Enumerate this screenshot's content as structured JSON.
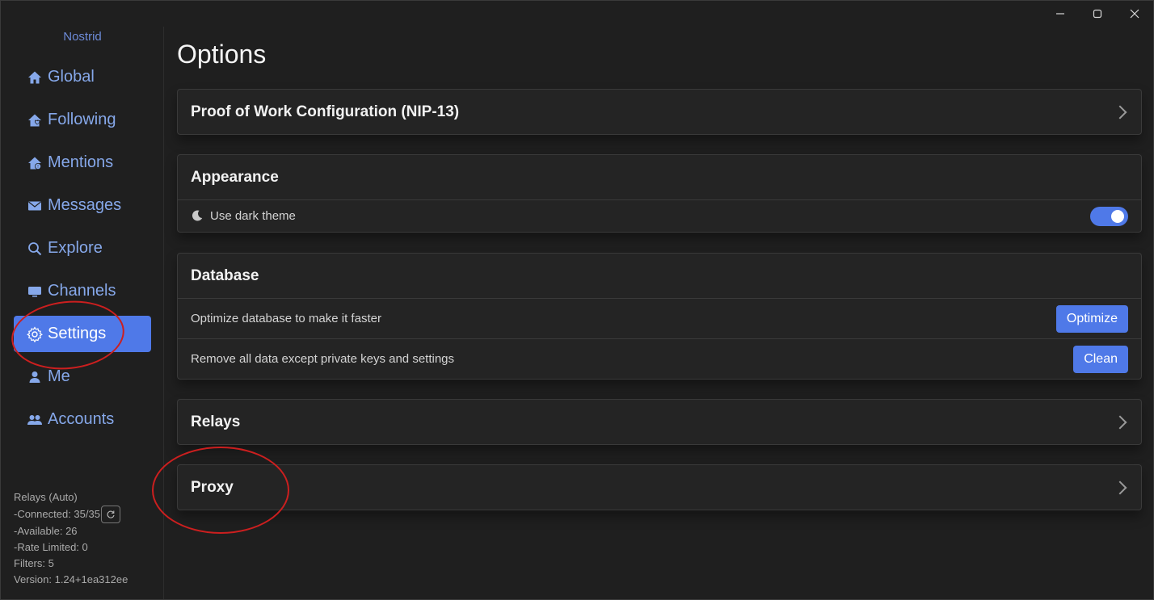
{
  "window": {
    "minimize_label": "—",
    "maximize_label": "☐",
    "close_label": "✕"
  },
  "sidebar": {
    "brand": "Nostrid",
    "items": [
      {
        "label": "Global",
        "icon": "home-icon"
      },
      {
        "label": "Following",
        "icon": "home-heart-icon"
      },
      {
        "label": "Mentions",
        "icon": "home-mention-icon"
      },
      {
        "label": "Messages",
        "icon": "envelope-icon"
      },
      {
        "label": "Explore",
        "icon": "search-icon"
      },
      {
        "label": "Channels",
        "icon": "monitor-icon"
      },
      {
        "label": "Settings",
        "icon": "gear-icon",
        "active": true
      },
      {
        "label": "Me",
        "icon": "user-icon"
      },
      {
        "label": "Accounts",
        "icon": "users-icon"
      }
    ],
    "status": {
      "relays": "Relays (Auto)",
      "connected": "-Connected: 35/35",
      "available": "-Available: 26",
      "rate_limited": "-Rate Limited: 0",
      "filters": "Filters: 5",
      "version": "Version: 1.24+1ea312ee"
    }
  },
  "main": {
    "title": "Options",
    "pow": {
      "title": "Proof of Work Configuration (NIP-13)"
    },
    "appearance": {
      "title": "Appearance",
      "dark_theme_label": "Use dark theme",
      "dark_theme_on": true
    },
    "database": {
      "title": "Database",
      "optimize_text": "Optimize database to make it faster",
      "optimize_button": "Optimize",
      "clean_text": "Remove all data except private keys and settings",
      "clean_button": "Clean"
    },
    "relays": {
      "title": "Relays"
    },
    "proxy": {
      "title": "Proxy"
    }
  },
  "colors": {
    "accent": "#4f79e8",
    "nav_text": "#86a8ea",
    "annotation": "#cc1f1f"
  }
}
